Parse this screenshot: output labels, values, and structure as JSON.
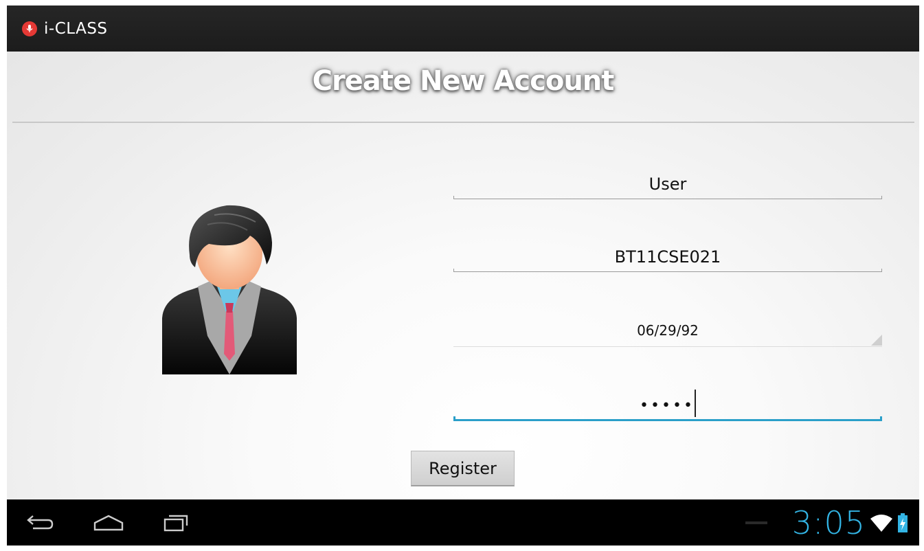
{
  "app": {
    "title": "i-CLASS",
    "icon": "mic-icon",
    "icon_color": "#e53935"
  },
  "page": {
    "title": "Create New Account"
  },
  "avatar": {
    "icon": "user-avatar-icon"
  },
  "form": {
    "name_value": "User",
    "id_value": "BT11CSE021",
    "date_value": "06/29/92",
    "password_masked": "•••••",
    "register_label": "Register",
    "focus_color": "#2a9fc9"
  },
  "navbar": {
    "back_icon": "back-icon",
    "home_icon": "home-icon",
    "recents_icon": "recent-apps-icon"
  },
  "status": {
    "time": "3:05",
    "accent": "#33b5e5",
    "wifi_icon": "wifi-icon",
    "battery_icon": "battery-charging-icon"
  }
}
